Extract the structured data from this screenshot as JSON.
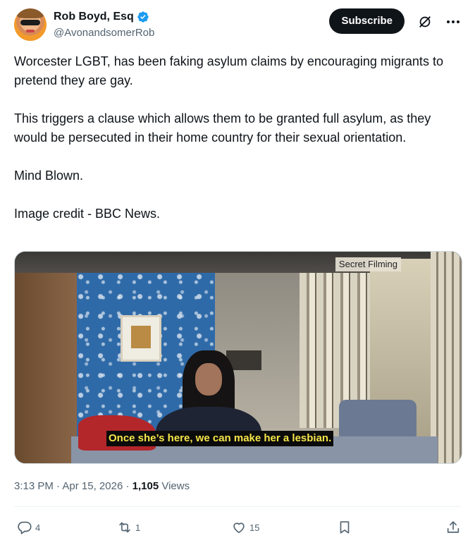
{
  "author": {
    "display_name": "Rob Boyd, Esq",
    "handle": "@AvonandsomerRob",
    "verified_color": "#1d9bf0"
  },
  "header": {
    "subscribe_label": "Subscribe",
    "grok_icon": "slashed-circle-icon",
    "more_icon": "more-horizontal-icon"
  },
  "tweet": {
    "paragraphs": [
      "Worcester LGBT, has been faking asylum claims by encouraging migrants to pretend they are gay.",
      "This triggers a clause which allows them to be granted full asylum, as they would be persecuted in their home country for their sexual orientation.",
      "Mind Blown.",
      "Image credit - BBC News."
    ]
  },
  "media": {
    "overlay_label": "Secret Filming",
    "subtitle": "Once she’s here, we can make her a lesbian."
  },
  "meta": {
    "time": "3:13 PM",
    "separator": "·",
    "date": "Apr 15, 2026",
    "views_count": "1,105",
    "views_label": "Views"
  },
  "actions": {
    "reply_count": "4",
    "repost_count": "1",
    "like_count": "15"
  },
  "colors": {
    "text_primary": "#0f1419",
    "text_secondary": "#536471",
    "subscribe_bg": "#0f1419",
    "subtitle_text": "#f5e64a"
  }
}
